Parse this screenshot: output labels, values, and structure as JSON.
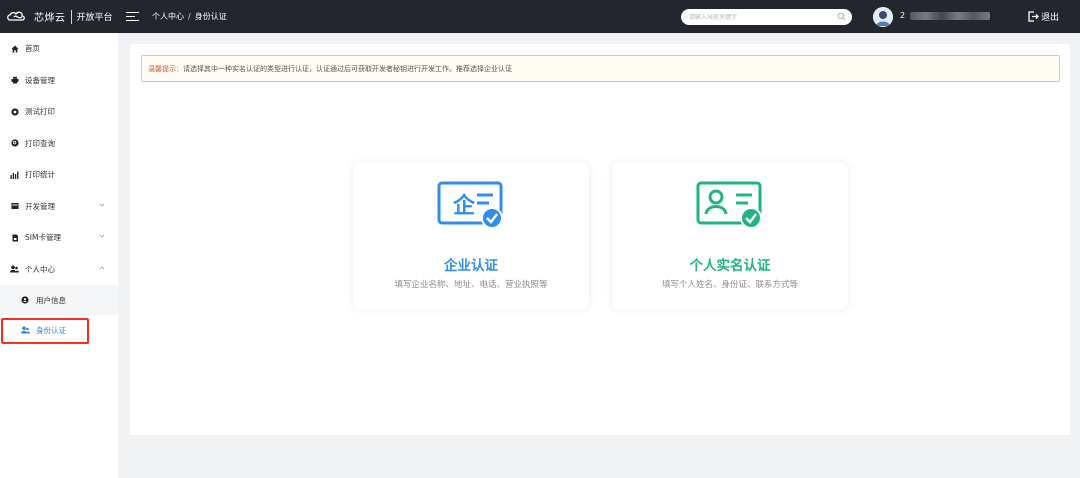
{
  "topbar": {
    "brand_name": "芯烨云",
    "brand_sub": "开放平台",
    "breadcrumb": [
      "个人中心",
      "身份认证"
    ],
    "breadcrumb_sep": "/",
    "search_placeholder": "请输入导航关键字",
    "username": "2",
    "logout_label": "退出"
  },
  "sidebar": {
    "items": [
      {
        "label": "首页",
        "icon": "home-icon"
      },
      {
        "label": "设备管理",
        "icon": "printer-icon"
      },
      {
        "label": "测试打印",
        "icon": "test-print-icon"
      },
      {
        "label": "打印查询",
        "icon": "print-query-icon"
      },
      {
        "label": "打印统计",
        "icon": "bar-chart-icon"
      },
      {
        "label": "开发管理",
        "icon": "dev-manage-icon",
        "expandable": true
      },
      {
        "label": "SIM卡管理",
        "icon": "sim-card-icon",
        "expandable": true
      },
      {
        "label": "个人中心",
        "icon": "user-group-icon",
        "expandable": true,
        "expanded": true
      }
    ],
    "sub_items": [
      {
        "label": "用户信息",
        "icon": "user-info-icon",
        "active": false
      },
      {
        "label": "身份认证",
        "icon": "identity-icon",
        "active": true
      }
    ]
  },
  "notice": {
    "label": "温馨提示：",
    "text": "请选择其中一种实名认证的类型进行认证，认证通过后可获取开发者秘钥进行开发工作。推荐选择企业认证"
  },
  "cards": {
    "enterprise": {
      "title": "企业认证",
      "desc": "填写企业名称、地址、电话、营业执照等",
      "color": "#2f8df0"
    },
    "personal": {
      "title": "个人实名认证",
      "desc": "填写个人姓名、身份证、联系方式等",
      "color": "#21b386"
    }
  },
  "colors": {
    "topbar": "#24262d",
    "active": "#2d80f0",
    "highlight": "#ff2a1f",
    "notice_border": "#f0c96a"
  }
}
